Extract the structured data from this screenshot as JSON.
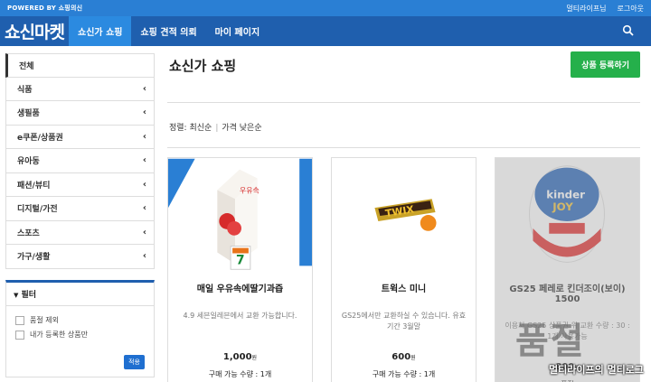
{
  "topbar": {
    "powered": "POWERED BY 쇼핑의신",
    "links": [
      "멀티라이프님",
      "로그아웃"
    ]
  },
  "nav": {
    "logo": "쇼신마켓",
    "tabs": [
      "쇼신가 쇼핑",
      "쇼핑 견적 의뢰",
      "마이 페이지"
    ],
    "active_tab": 0,
    "search_icon": "search-icon"
  },
  "sidebar": {
    "categories": [
      {
        "label": "전체",
        "chevron": false
      },
      {
        "label": "식품",
        "chevron": true
      },
      {
        "label": "생필품",
        "chevron": true
      },
      {
        "label": "e쿠폰/상품권",
        "chevron": true
      },
      {
        "label": "유아동",
        "chevron": true
      },
      {
        "label": "패션/뷰티",
        "chevron": true
      },
      {
        "label": "디지털/가전",
        "chevron": true
      },
      {
        "label": "스포츠",
        "chevron": true
      },
      {
        "label": "가구/생활",
        "chevron": true
      }
    ],
    "filter": {
      "title": "필터",
      "options": [
        "품절 제외",
        "내가 등록한 상품만"
      ],
      "apply": "적용"
    }
  },
  "main": {
    "title": "쇼신가 쇼핑",
    "register_button": "상품 등록하기",
    "sort": {
      "label": "정렬:",
      "options": [
        "최신순",
        "가격 낮은순"
      ]
    },
    "products": [
      {
        "name": "매일 우유속에딸기과즙",
        "desc": "4.9 세븐일레븐에서 교환 가능합니다.",
        "price": "1,000",
        "price_unit": "원",
        "limit": "구매 가능 수량 : 1개",
        "sold_out": false
      },
      {
        "name": "트윅스 미니",
        "desc": "GS25에서만 교환하실 수 있습니다. 유효기간 3월말",
        "price": "600",
        "price_unit": "원",
        "limit": "구매 가능 수량 : 1개",
        "sold_out": false
      },
      {
        "name": "GS25 페레로 킨더조이(보이) 1500",
        "desc": "이용처 GS25 상품권 위 교환 수량 : 30 : 1개 사용가능",
        "price": "800",
        "price_unit": "원",
        "limit": "품절",
        "sold_out": true,
        "sold_out_label": "품절"
      }
    ]
  },
  "watermark": "멀티라이프의 멀티로그",
  "colors": {
    "topbar": "#2a7fd4",
    "nav": "#1f5fae",
    "nav_active": "#2b8ae0",
    "register": "#25b04b",
    "apply": "#1f6fd0"
  }
}
